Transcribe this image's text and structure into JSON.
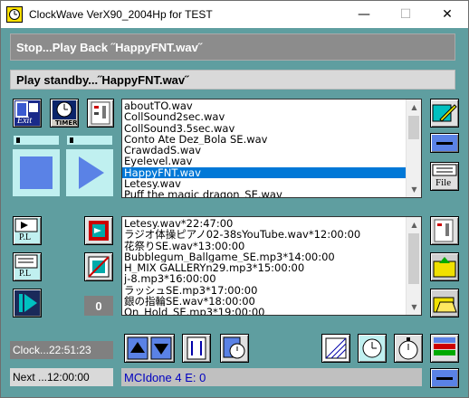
{
  "window": {
    "title": "ClockWave VerX90_2004Hp for TEST"
  },
  "titlebar": {
    "minimize": "—",
    "maximize": "☐",
    "close": "✕"
  },
  "status": {
    "line1": "Stop...Play Back ˝HappyFNT.wav˝",
    "line2": "Play standby...˝HappyFNT.wav˝"
  },
  "buttons": {
    "exit_label": "Exit",
    "timer_label": "TIMER",
    "file_label": "File",
    "pl_label_1": "P.L",
    "pl_label_2": "P.L",
    "counter": "0"
  },
  "filelist": {
    "items": [
      "aboutTO.wav",
      "CollSound2sec.wav",
      "CollSound3.5sec.wav",
      "Conto Ate Dez_Bola SE.wav",
      "CrawdadS.wav",
      "Eyelevel.wav",
      "HappyFNT.wav",
      "Letesy.wav",
      "Puff the magic dragon_SE.wav"
    ],
    "selected_index": 6
  },
  "schedule": {
    "items": [
      "Letesy.wav*22:47:00",
      "ラジオ体操ピアノ02-38sYouTube.wav*12:00:00",
      "花祭りSE.wav*13:00:00",
      "Bubblegum_Ballgame_SE.mp3*14:00:00",
      "H_MIX GALLERYn29.mp3*15:00:00",
      "j-8.mp3*16:00:00",
      "ラッシュSE.mp3*17:00:00",
      "銀の指輪SE.wav*18:00:00",
      "On_Hold_SE.mp3*19:00:00"
    ]
  },
  "clock": {
    "text": "Clock...22:51:23"
  },
  "next": {
    "text": "Next ...12:00:00"
  },
  "mci": {
    "text": "MCIdone  4 E: 0"
  },
  "colors": {
    "bg": "#5f9ea0",
    "status_bg": "#8c8c8c",
    "blue_btn": "#5a82e6",
    "panel_cyan": "#c0f0f0"
  }
}
